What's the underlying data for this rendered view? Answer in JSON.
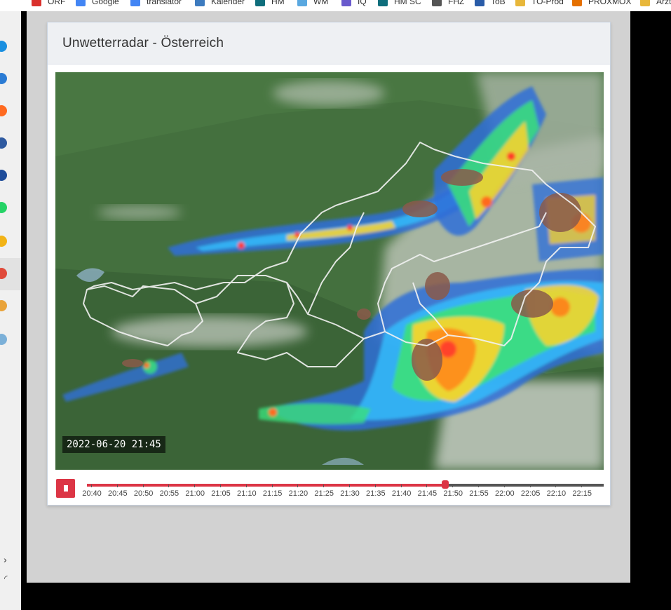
{
  "bookmarks": [
    {
      "label": "ORF",
      "icon": "orf-icon",
      "color": "#d9302c"
    },
    {
      "label": "Google",
      "icon": "google-icon",
      "color": "#4285f4"
    },
    {
      "label": "translator",
      "icon": "google-icon",
      "color": "#4285f4"
    },
    {
      "label": "Kalender",
      "icon": "calendar-icon",
      "color": "#3d7bbf"
    },
    {
      "label": "HM",
      "icon": "hm-icon",
      "color": "#0f6e7c"
    },
    {
      "label": "WM",
      "icon": "wm-icon",
      "color": "#5aa8e0"
    },
    {
      "label": "IQ",
      "icon": "iq-icon",
      "color": "#6a5acd"
    },
    {
      "label": "HM SC",
      "icon": "hm-icon",
      "color": "#0f6e7c"
    },
    {
      "label": "FHZ",
      "icon": "plus-circle-icon",
      "color": "#555555"
    },
    {
      "label": "ToB",
      "icon": "info-icon",
      "color": "#2a5ca8"
    },
    {
      "label": "TO-Prod",
      "icon": "folder-icon",
      "color": "#e8b73a"
    },
    {
      "label": "PROXMOX",
      "icon": "proxmox-icon",
      "color": "#e57000"
    },
    {
      "label": "Ärzte",
      "icon": "folder-icon",
      "color": "#e8b73a"
    }
  ],
  "card": {
    "title": "Unwetterradar - Österreich"
  },
  "radar": {
    "timestamp": "2022-06-20 21:45"
  },
  "timeline": {
    "stop_icon": "stop-icon",
    "progress": 0.693,
    "labels": [
      "20:40",
      "20:45",
      "20:50",
      "20:55",
      "21:00",
      "21:05",
      "21:10",
      "21:15",
      "21:20",
      "21:25",
      "21:30",
      "21:35",
      "21:40",
      "21:45",
      "21:50",
      "21:55",
      "22:00",
      "22:05",
      "22:10",
      "22:15"
    ]
  },
  "colors": {
    "accent": "#dc3545",
    "map_green": "#3f6a3a",
    "card_header": "#eef0f3"
  }
}
